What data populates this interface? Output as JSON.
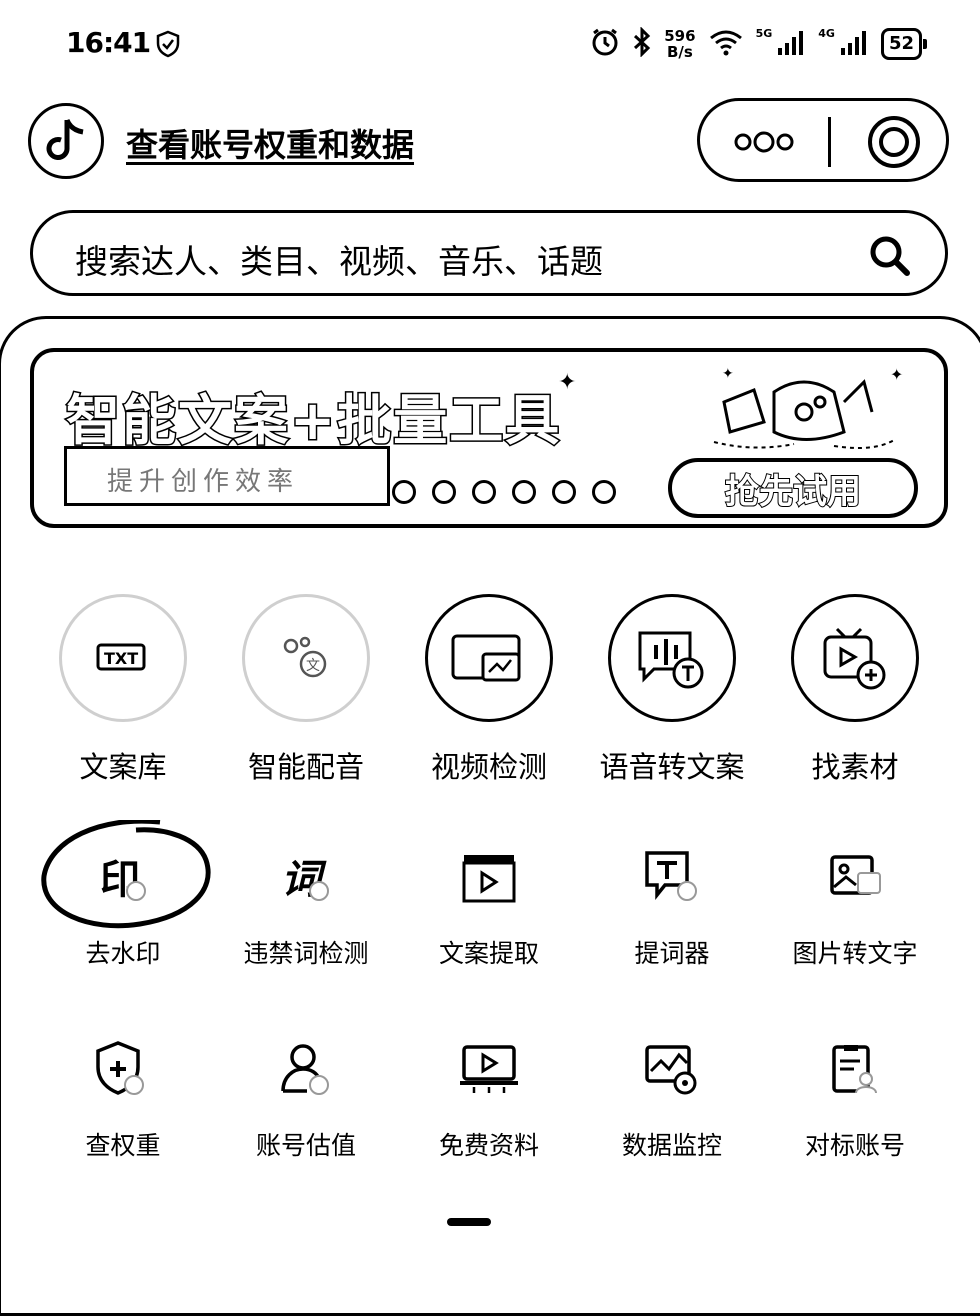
{
  "status_bar": {
    "time": "16:41",
    "net_speed_value": "596",
    "net_speed_unit": "B/s",
    "signal_1_tech": "5G",
    "signal_2_tech": "4G",
    "battery": "52"
  },
  "header": {
    "title": "查看账号权重和数据"
  },
  "search": {
    "placeholder": "搜索达人、类目、视频、音乐、话题"
  },
  "banner": {
    "title": "智能文案+批量工具",
    "subtitle": "提升创作效率",
    "button_label": "抢先试用",
    "carousel_count": 6
  },
  "tools_row1": [
    {
      "label": "文案库",
      "icon": "text-library-icon"
    },
    {
      "label": "智能配音",
      "icon": "ai-voiceover-icon"
    },
    {
      "label": "视频检测",
      "icon": "video-check-icon"
    },
    {
      "label": "语音转文案",
      "icon": "speech-to-text-icon"
    },
    {
      "label": "找素材",
      "icon": "find-material-icon"
    }
  ],
  "tools_row2": [
    {
      "label": "去水印",
      "icon": "remove-watermark-icon"
    },
    {
      "label": "违禁词检测",
      "icon": "banned-words-icon"
    },
    {
      "label": "文案提取",
      "icon": "text-extract-icon"
    },
    {
      "label": "提词器",
      "icon": "teleprompter-icon"
    },
    {
      "label": "图片转文字",
      "icon": "image-to-text-icon"
    }
  ],
  "tools_row3": [
    {
      "label": "查权重",
      "icon": "check-weight-icon"
    },
    {
      "label": "账号估值",
      "icon": "account-value-icon"
    },
    {
      "label": "免费资料",
      "icon": "free-material-icon"
    },
    {
      "label": "数据监控",
      "icon": "data-monitor-icon"
    },
    {
      "label": "对标账号",
      "icon": "benchmark-account-icon"
    }
  ]
}
